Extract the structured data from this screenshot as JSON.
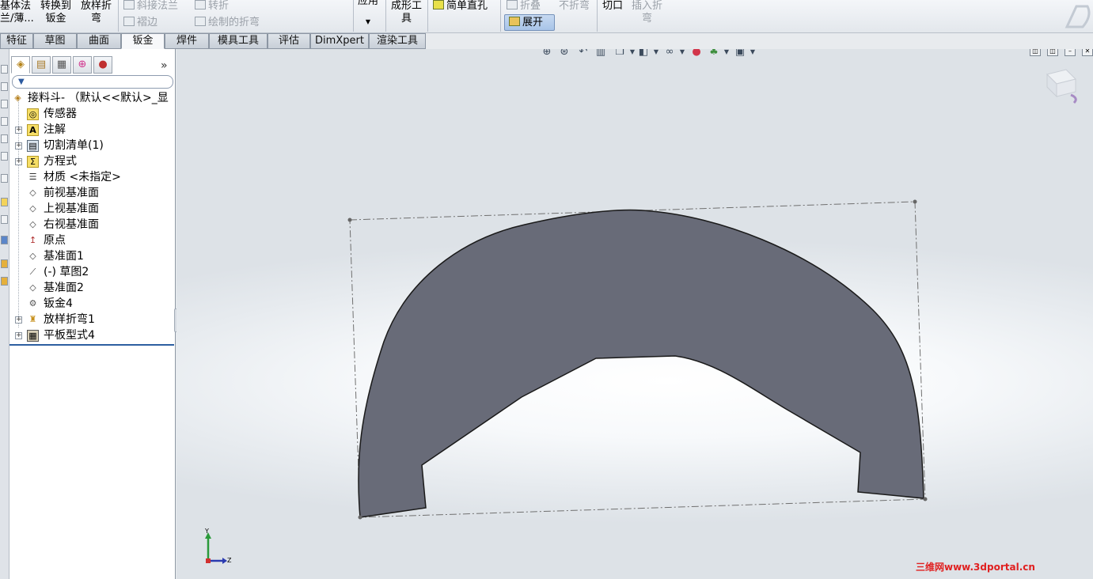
{
  "ribbon": {
    "base_flange": "基体法",
    "base_flange_2": "兰/薄...",
    "convert_1": "转换到",
    "convert_2": "钣金",
    "loft_bend_1": "放样折",
    "loft_bend_2": "弯",
    "miter_flange": "斜接法兰",
    "hem": "褶边",
    "jog": "转折",
    "sketched_bend": "绘制的折弯",
    "apply": "应用",
    "forming_tool_1": "成形工",
    "forming_tool_2": "具",
    "simple_hole": "简单直孔",
    "fold": "折叠",
    "unfold": "不折弯",
    "flatten": "展开",
    "cut": "切口",
    "insert_bends_1": "插入折",
    "insert_bends_2": "弯"
  },
  "tabs": [
    "特征",
    "草图",
    "曲面",
    "钣金",
    "焊件",
    "模具工具",
    "评估",
    "DimXpert",
    "渲染工具"
  ],
  "active_tab": "钣金",
  "fm": {
    "expand_label": "»",
    "tree": [
      {
        "label": "接料斗- （默认<<默认>_显",
        "icon": "part-icon"
      },
      {
        "label": "传感器",
        "icon": "sensor-icon"
      },
      {
        "label": "注解",
        "icon": "annotation-icon",
        "expander": "+"
      },
      {
        "label": "切割清单(1)",
        "icon": "cut-list-icon",
        "expander": "+"
      },
      {
        "label": "方程式",
        "icon": "equation-icon",
        "expander": "+"
      },
      {
        "label": "材质 <未指定>",
        "icon": "material-icon"
      },
      {
        "label": "前视基准面",
        "icon": "plane-icon"
      },
      {
        "label": "上视基准面",
        "icon": "plane-icon"
      },
      {
        "label": "右视基准面",
        "icon": "plane-icon"
      },
      {
        "label": "原点",
        "icon": "origin-icon"
      },
      {
        "label": "基准面1",
        "icon": "plane-icon"
      },
      {
        "label": "(-) 草图2",
        "icon": "sketch-icon"
      },
      {
        "label": "基准面2",
        "icon": "plane-icon"
      },
      {
        "label": "钣金4",
        "icon": "sheet-metal-icon"
      },
      {
        "label": "放样折弯1",
        "icon": "lofted-bend-icon",
        "expander": "+"
      },
      {
        "label": "平板型式4",
        "icon": "flat-pattern-icon",
        "expander": "+"
      }
    ]
  },
  "axes": {
    "y": "Y",
    "z": "Z"
  },
  "watermark": "三维网www.3dportal.cn",
  "colors": {
    "part_fill": "#686b78",
    "part_edge": "#1a1a1a",
    "bbox_line": "#707070"
  }
}
